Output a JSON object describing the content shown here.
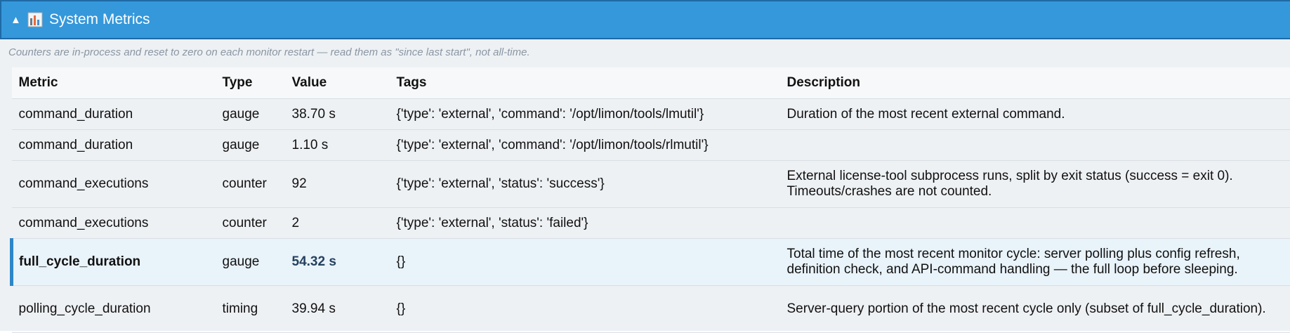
{
  "header": {
    "toggle_glyph": "▲",
    "icon": "bar-chart-icon",
    "title": "System Metrics",
    "color": "#3498db"
  },
  "note": "Counters are in-process and reset to zero on each monitor restart — read them as \"since last start\", not all-time.",
  "table": {
    "columns": [
      "Metric",
      "Type",
      "Value",
      "Tags",
      "Description"
    ],
    "rows": [
      {
        "metric": "command_duration",
        "type": "gauge",
        "value": "38.70 s",
        "tags": "{'type': 'external', 'command': '/opt/limon/tools/lmutil'}",
        "description": "Duration of the most recent external command."
      },
      {
        "metric": "command_duration",
        "type": "gauge",
        "value": "1.10 s",
        "tags": "{'type': 'external', 'command': '/opt/limon/tools/rlmutil'}",
        "description": ""
      },
      {
        "metric": "command_executions",
        "type": "counter",
        "value": "92",
        "tags": "{'type': 'external', 'status': 'success'}",
        "description": "External license-tool subprocess runs, split by exit status (success = exit 0). Timeouts/crashes are not counted."
      },
      {
        "metric": "command_executions",
        "type": "counter",
        "value": "2",
        "tags": "{'type': 'external', 'status': 'failed'}",
        "description": ""
      },
      {
        "metric": "full_cycle_duration",
        "type": "gauge",
        "value": "54.32 s",
        "tags": "{}",
        "description": "Total time of the most recent monitor cycle: server polling plus config refresh, definition check, and API-command handling — the full loop before sleeping.",
        "highlighted": true
      },
      {
        "metric": "polling_cycle_duration",
        "type": "timing",
        "value": "39.94 s",
        "tags": "{}",
        "description": "Server-query portion of the most recent cycle only (subset of full_cycle_duration)."
      }
    ]
  }
}
